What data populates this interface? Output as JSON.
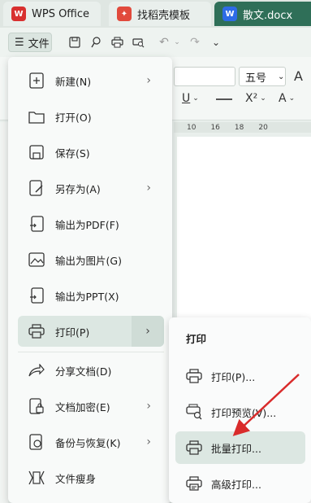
{
  "tabs": [
    {
      "label": "WPS Office",
      "icon": "wps-logo-icon"
    },
    {
      "label": "找稻壳模板",
      "icon": "docer-icon"
    },
    {
      "label": "散文.docx",
      "icon": "word-doc-icon",
      "icon_text": "W"
    }
  ],
  "toolbar": {
    "file_label": "文件",
    "font_size": "五号"
  },
  "ruler_marks": [
    "10",
    "16",
    "18",
    "20"
  ],
  "menu": [
    {
      "label": "新建(N)",
      "icon": "new-file-icon",
      "has_submenu": true
    },
    {
      "label": "打开(O)",
      "icon": "folder-icon",
      "has_submenu": false
    },
    {
      "label": "保存(S)",
      "icon": "save-icon",
      "has_submenu": false
    },
    {
      "label": "另存为(A)",
      "icon": "save-as-icon",
      "has_submenu": true
    },
    {
      "label": "输出为PDF(F)",
      "icon": "pdf-export-icon",
      "has_submenu": false
    },
    {
      "label": "输出为图片(G)",
      "icon": "image-export-icon",
      "has_submenu": false
    },
    {
      "label": "输出为PPT(X)",
      "icon": "ppt-export-icon",
      "has_submenu": false
    },
    {
      "label": "打印(P)",
      "icon": "printer-icon",
      "has_submenu": true,
      "active": true
    },
    {
      "label": "分享文档(D)",
      "icon": "share-icon",
      "has_submenu": false
    },
    {
      "label": "文档加密(E)",
      "icon": "encrypt-icon",
      "has_submenu": true
    },
    {
      "label": "备份与恢复(K)",
      "icon": "backup-icon",
      "has_submenu": true
    },
    {
      "label": "文件瘦身",
      "icon": "slim-file-icon",
      "has_submenu": false
    }
  ],
  "submenu": {
    "title": "打印",
    "items": [
      {
        "label": "打印(P)...",
        "icon": "printer-icon"
      },
      {
        "label": "打印预览(V)...",
        "icon": "print-preview-icon"
      },
      {
        "label": "批量打印...",
        "icon": "batch-print-icon",
        "highlighted": true
      },
      {
        "label": "高级打印...",
        "icon": "advanced-print-icon"
      }
    ]
  },
  "colors": {
    "accent": "#2f6f58",
    "arrow": "#d92b2b",
    "highlight": "#dce7e2"
  }
}
